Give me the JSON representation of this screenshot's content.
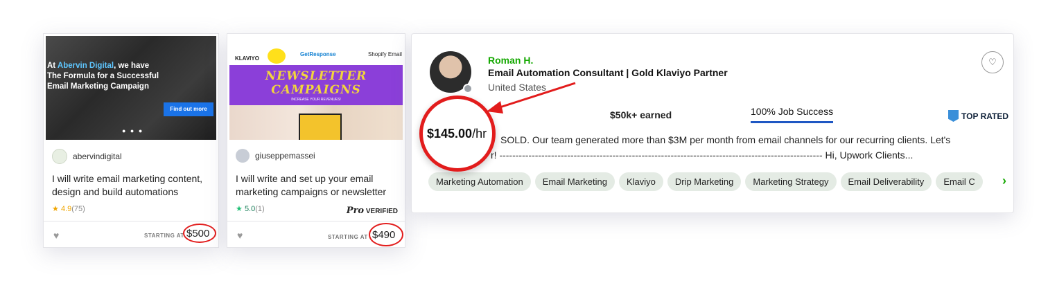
{
  "gig1": {
    "thumb_line1_plain": "At ",
    "thumb_line1_hl": "Abervin Digital",
    "thumb_line1_rest": ", we have",
    "thumb_line2": "The Formula for a Successful",
    "thumb_line3": "Email Marketing Campaign",
    "thumb_cta": "Find out more",
    "seller": "abervindigital",
    "title": "I will write email marketing content, design and build automations",
    "rating": "4.9",
    "reviews": "(75)",
    "starting_label": "STARTING AT",
    "price": "$500"
  },
  "gig2": {
    "brand_klaviyo": "KLAVIYO",
    "brand_getresponse": "GetResponse",
    "brand_shopify": "Shopify Email",
    "thumb_title1": "NEWSLETTER",
    "thumb_title2": "CAMPAIGNS",
    "thumb_sub": "INCREASE YOUR REVENUES!",
    "seller": "giuseppemassei",
    "title": "I will write and set up your email marketing campaigns or newsletter",
    "rating": "5.0",
    "reviews": "(1)",
    "pro_label": "Pro",
    "verified_label": "VERIFIED",
    "starting_label": "STARTING AT",
    "price": "$490"
  },
  "profile": {
    "name": "Roman H.",
    "headline": "Email Automation Consultant | Gold Klaviyo Partner",
    "country": "United States",
    "rate": "$145.00",
    "rate_unit": "/hr",
    "earned": "$50k+ earned",
    "job_success": "100% Job Success",
    "top_rated": "TOP RATED",
    "desc_line1": "SOLD. Our team generated more than $3M per month from email channels for our recurring clients. Let's",
    "desc_line2": "r! ---------------------------------------------------------------------------------------------------- Hi, Upwork Clients...",
    "skills": [
      "Marketing Automation",
      "Email Marketing",
      "Klaviyo",
      "Drip Marketing",
      "Marketing Strategy",
      "Email Deliverability",
      "Email C"
    ]
  },
  "colors": {
    "upwork_green": "#14a800",
    "annotation_red": "#e21c1c",
    "job_success_underline": "#1f57c3"
  }
}
